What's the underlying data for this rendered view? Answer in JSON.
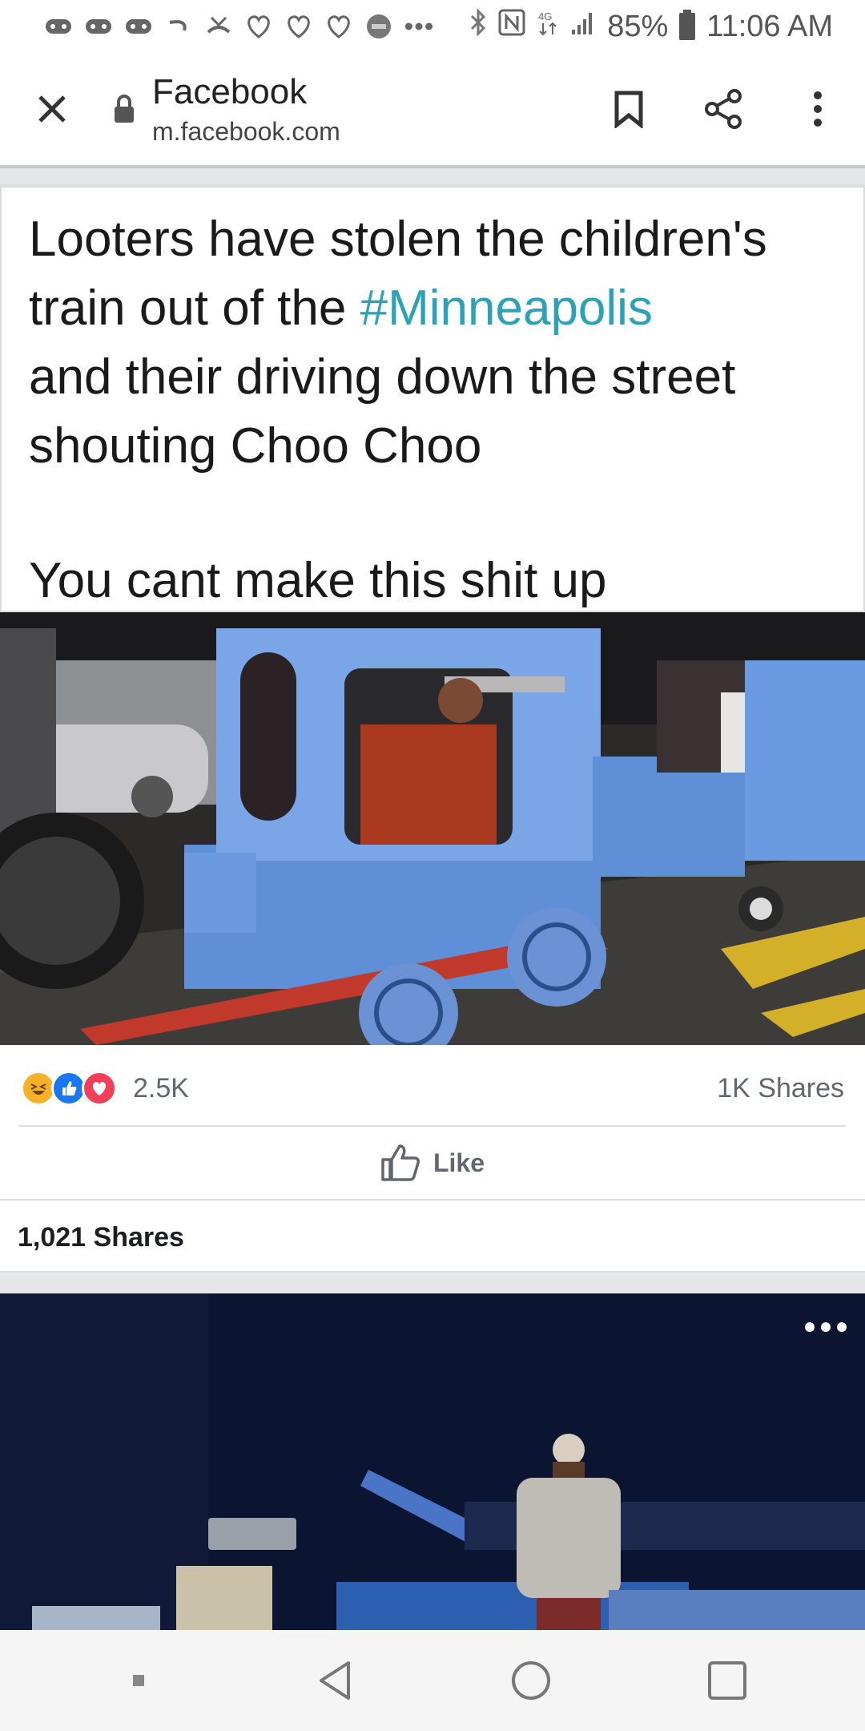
{
  "status_bar": {
    "battery": "85%",
    "time": "11:06 AM",
    "network": "4G"
  },
  "browser": {
    "title": "Facebook",
    "url": "m.facebook.com"
  },
  "post": {
    "text_line1": "Looters have stolen the children's",
    "text_line2_prefix": "train out of the ",
    "hashtag": "#Minneapolis",
    "text_line3": "and their driving down the street",
    "text_line4": "shouting Choo Choo",
    "text_line5": "You cant make this shit up",
    "reaction_count": "2.5K",
    "shares_short": "1K Shares",
    "like_label": "Like",
    "shares_full": "1,021 Shares"
  },
  "colors": {
    "hashtag": "#2aa3b8",
    "like_blue": "#1877f2",
    "love_red": "#f33e58",
    "haha_yellow": "#f7b125"
  },
  "icons": [
    "close-icon",
    "lock-icon",
    "bookmark-icon",
    "share-icon",
    "more-vert-icon",
    "thumb-up-icon",
    "back-icon",
    "home-icon",
    "recents-icon"
  ]
}
